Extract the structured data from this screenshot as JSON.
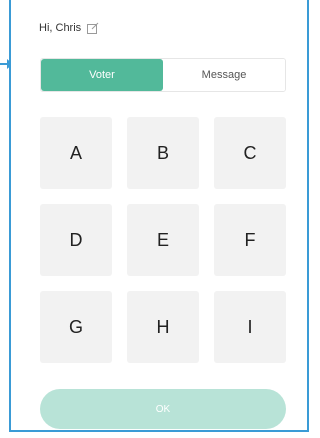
{
  "header": {
    "greeting": "Hi, Chris",
    "edit_icon": "edit-icon"
  },
  "tabs": [
    {
      "label": "Voter",
      "active": true
    },
    {
      "label": "Message",
      "active": false
    }
  ],
  "keypad": {
    "keys": [
      "A",
      "B",
      "C",
      "D",
      "E",
      "F",
      "G",
      "H",
      "I"
    ]
  },
  "footer": {
    "ok_label": "OK"
  },
  "colors": {
    "accent": "#52b99a",
    "accent_disabled": "#b8e3d7",
    "frame_border": "#3a9bd6",
    "key_background": "#f2f2f2"
  }
}
